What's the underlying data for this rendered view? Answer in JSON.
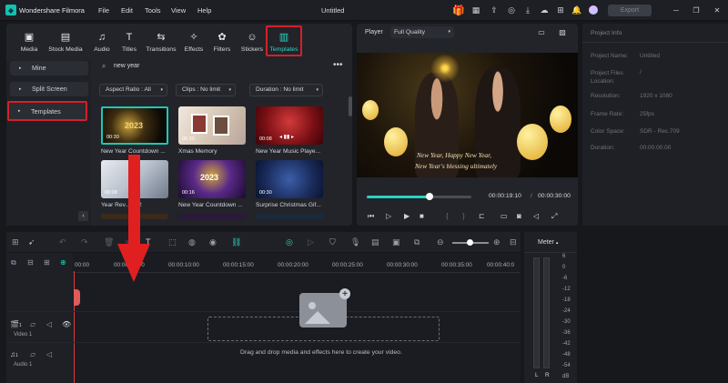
{
  "app": {
    "name": "Wondershare Filmora",
    "project": "Untitled",
    "export_label": "Export"
  },
  "menu": [
    "File",
    "Edit",
    "Tools",
    "View",
    "Help"
  ],
  "toolbar": [
    {
      "label": "Media",
      "icon": "media-icon"
    },
    {
      "label": "Stock Media",
      "icon": "stock-media-icon"
    },
    {
      "label": "Audio",
      "icon": "audio-icon"
    },
    {
      "label": "Titles",
      "icon": "titles-icon"
    },
    {
      "label": "Transitions",
      "icon": "transitions-icon"
    },
    {
      "label": "Effects",
      "icon": "effects-icon"
    },
    {
      "label": "Filters",
      "icon": "filters-icon"
    },
    {
      "label": "Stickers",
      "icon": "stickers-icon"
    },
    {
      "label": "Templates",
      "icon": "templates-icon",
      "active": true
    }
  ],
  "sidebar": [
    "Mine",
    "Split Screen",
    "Templates"
  ],
  "search": {
    "value": "new year"
  },
  "filters": [
    "Aspect Ratio : All",
    "Clips : No limit",
    "Duration : No limit"
  ],
  "templates": [
    {
      "title": "New Year Countdown ...",
      "time": "00:30"
    },
    {
      "title": "Xmas Memory",
      "time": "00:30"
    },
    {
      "title": "New Year Music Playe...",
      "time": "00:08"
    },
    {
      "title": "Year Rev...3 02",
      "time": "00:08"
    },
    {
      "title": "New Year Countdown ...",
      "time": "00:16"
    },
    {
      "title": "Surprise Christmas Gif...",
      "time": "00:30"
    }
  ],
  "player": {
    "label": "Player",
    "quality": "Full Quality",
    "current": "00:00:19:10",
    "total": "00:00:30:00",
    "progress": 0.6,
    "caption1": "New Year, Happy New Year,",
    "caption2": "New Year's blessing ultimately"
  },
  "project_info": {
    "title": "Project Info",
    "rows": [
      {
        "k": "Project Name:",
        "v": "Untitled"
      },
      {
        "k": "Project Files Location:",
        "v": "/"
      },
      {
        "k": "Resolution:",
        "v": "1920 x 1080"
      },
      {
        "k": "Frame Rate:",
        "v": "25fps"
      },
      {
        "k": "Color Space:",
        "v": "SDR - Rec.709"
      },
      {
        "k": "Duration:",
        "v": "00:00:00:00"
      }
    ]
  },
  "timeline": {
    "ticks": [
      "00:00",
      "00:00:05:00",
      "00:00:10:00",
      "00:00:15:00",
      "00:00:20:00",
      "00:00:25:00",
      "00:00:30:00",
      "00:00:35:00",
      "00:00:40:0"
    ],
    "drop_hint": "Drag and drop media and effects here to create your video.",
    "tracks": [
      {
        "name": "Video 1",
        "num": "1"
      },
      {
        "name": "Audio 1",
        "num": "1"
      }
    ]
  },
  "meter": {
    "title": "Meter",
    "scale": [
      "6",
      "0",
      "-6",
      "-12",
      "-18",
      "-24",
      "-30",
      "-36",
      "-42",
      "-48",
      "-54",
      "dB"
    ],
    "channels": [
      "L",
      "R"
    ]
  }
}
